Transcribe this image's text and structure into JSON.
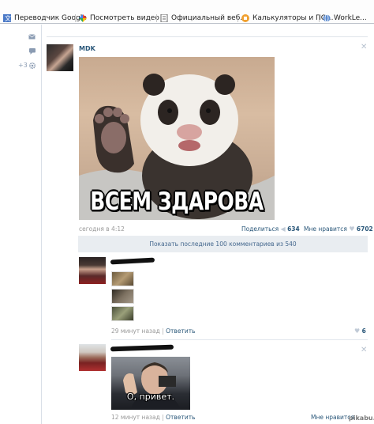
{
  "browser": {
    "bookmarks": [
      {
        "label": "Переводчик Google",
        "icon": "translate-icon"
      },
      {
        "label": "Посмотреть видео",
        "icon": "pinwheel-icon"
      },
      {
        "label": "Официальный веб...",
        "icon": "page-icon"
      },
      {
        "label": "Калькуляторы и ПО...",
        "icon": "calculator-icon"
      },
      {
        "label": "WorkLe...",
        "icon": "globe-icon"
      }
    ]
  },
  "sidebar": {
    "count": "+3"
  },
  "post": {
    "author": "MDK",
    "photo_caption": "ВСЕМ ЗДАРОВА",
    "time": "сегодня в 4:12",
    "share_label": "Поделиться",
    "share_count": "634",
    "like_label": "Мне нравится",
    "like_count": "6702",
    "show_comments_label": "Показать последние 100 комментариев из 540"
  },
  "comments": [
    {
      "time": "29 минут назад",
      "reply_label": "Ответить",
      "like_count": "6"
    },
    {
      "photo_caption": "О, привет.",
      "time": "12 минут назад",
      "reply_label": "Ответить",
      "like_label": "Мне нравится"
    }
  ],
  "watermark": "pikabu.ru",
  "colors": {
    "link": "#2b587a",
    "button_bg": "#e9edf1",
    "muted": "#999999"
  }
}
